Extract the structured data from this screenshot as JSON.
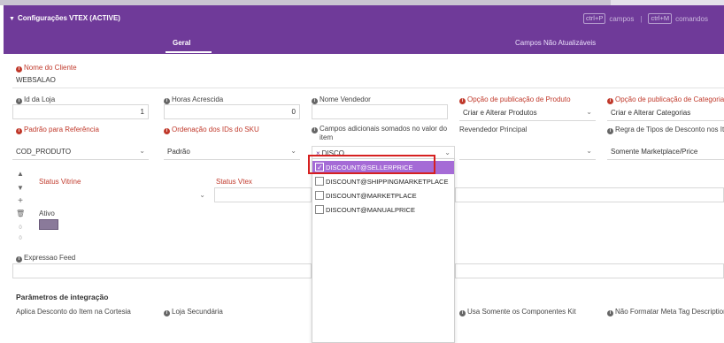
{
  "header": {
    "title": "Configurações VTEX (ACTIVE)",
    "shortcut1_key": "ctrl+P",
    "shortcut1_label": "campos",
    "separator": "|",
    "shortcut2_key": "ctrl+M",
    "shortcut2_label": "comandos"
  },
  "tabs": [
    {
      "label": "Geral",
      "active": true
    },
    {
      "label": "Campos Não Atualizáveis",
      "active": false
    }
  ],
  "form": {
    "nome_cliente_label": "Nome do Cliente",
    "nome_cliente_value": "WEBSALAO",
    "id_loja_label": "Id da Loja",
    "id_loja_value": "1",
    "horas_label": "Horas Acrescida",
    "horas_value": "0",
    "nome_vendedor_label": "Nome Vendedor",
    "nome_vendedor_value": "",
    "opcao_produto_label": "Opção de publicação de Produto",
    "opcao_produto_value": "Criar e Alterar Produtos",
    "opcao_categoria_label": "Opção de publicação de Categoria",
    "opcao_categoria_value": "Criar e Alterar Categorias",
    "padrao_ref_label": "Padrão para Referência",
    "padrao_ref_value": "COD_PRODUTO",
    "ordenacao_label": "Ordenação dos IDs do SKU",
    "ordenacao_value": "Padrão",
    "campos_adicionais_label_1": "Campos adicionais somados no valor do",
    "campos_adicionais_label_2": "item",
    "campos_adicionais_chip": "DISCO...",
    "revendedor_label": "Revendedor Principal",
    "revendedor_value": "",
    "regra_desconto_label": "Regra de Tipos de Desconto nos Ite",
    "regra_desconto_value": "Somente Marketplace/Price",
    "status_vitrine_label": "Status Vitrine",
    "status_vtex_label": "Status Vtex",
    "ativo_label": "Ativo",
    "expressao_feed_label": "Expressao Feed"
  },
  "dropdown_options": [
    {
      "label": "DISCOUNT@SELLERPRICE",
      "checked": true
    },
    {
      "label": "DISCOUNT@SHIPPINGMARKETPLACE",
      "checked": false
    },
    {
      "label": "DISCOUNT@MARKETPLACE",
      "checked": false
    },
    {
      "label": "DISCOUNT@MANUALPRICE",
      "checked": false
    }
  ],
  "integracao": {
    "title": "Parâmetros de integração",
    "aplica_desconto_label": "Aplica Desconto do Item na Cortesia",
    "loja_secundaria_label": "Loja Secundária",
    "componentes_kit_label": "Usa Somente os Componentes Kit",
    "meta_tag_label": "Não Formatar Meta Tag Description"
  },
  "side_controls": [
    "▲",
    "▼",
    "+",
    "🗑",
    "0",
    "0"
  ],
  "colors": {
    "header": "#6f3a99",
    "selected_option": "#a56bd6",
    "required_label": "#c0392b",
    "highlight": "#d62020"
  }
}
